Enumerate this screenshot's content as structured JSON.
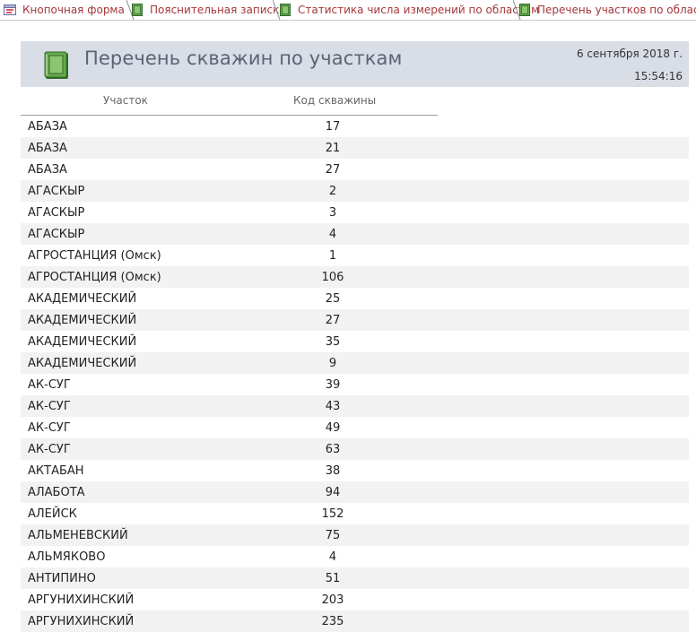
{
  "tabs": [
    {
      "label": "Кнопочная форма",
      "icon": "form-icon"
    },
    {
      "label": "Пояснительная записка",
      "icon": "report-icon"
    },
    {
      "label": "Статистика числа измерений по областям",
      "icon": "report-icon"
    },
    {
      "label": "Перечень участков по областям",
      "icon": "report-icon"
    }
  ],
  "report": {
    "title": "Перечень скважин по участкам",
    "date": "6 сентября 2018 г.",
    "time": "15:54:16",
    "columns": {
      "area": "Участок",
      "code": "Код скважины"
    },
    "rows": [
      {
        "area": "АБАЗА",
        "code": "17"
      },
      {
        "area": "АБАЗА",
        "code": "21"
      },
      {
        "area": "АБАЗА",
        "code": "27"
      },
      {
        "area": "АГАСКЫР",
        "code": "2"
      },
      {
        "area": "АГАСКЫР",
        "code": "3"
      },
      {
        "area": "АГАСКЫР",
        "code": "4"
      },
      {
        "area": "АГРОСТАНЦИЯ (Омск)",
        "code": "1"
      },
      {
        "area": "АГРОСТАНЦИЯ (Омск)",
        "code": "106"
      },
      {
        "area": "АКАДЕМИЧЕСКИЙ",
        "code": "25"
      },
      {
        "area": "АКАДЕМИЧЕСКИЙ",
        "code": "27"
      },
      {
        "area": "АКАДЕМИЧЕСКИЙ",
        "code": "35"
      },
      {
        "area": "АКАДЕМИЧЕСКИЙ",
        "code": "9"
      },
      {
        "area": "АК-СУГ",
        "code": "39"
      },
      {
        "area": "АК-СУГ",
        "code": "43"
      },
      {
        "area": "АК-СУГ",
        "code": "49"
      },
      {
        "area": "АК-СУГ",
        "code": "63"
      },
      {
        "area": "АКТАБАН",
        "code": "38"
      },
      {
        "area": "АЛАБОТА",
        "code": "94"
      },
      {
        "area": "АЛЕЙСК",
        "code": "152"
      },
      {
        "area": "АЛЬМЕНЕВСКИЙ",
        "code": "75"
      },
      {
        "area": "АЛЬМЯКОВО",
        "code": "4"
      },
      {
        "area": "АНТИПИНО",
        "code": "51"
      },
      {
        "area": "АРГУНИХИНСКИЙ",
        "code": "203"
      },
      {
        "area": "АРГУНИХИНСКИЙ",
        "code": "235"
      }
    ]
  },
  "colors": {
    "tab_text": "#a4373a",
    "header_band": "#d8dde6",
    "title_text": "#5b6473",
    "alt_row": "#f2f2f2"
  }
}
